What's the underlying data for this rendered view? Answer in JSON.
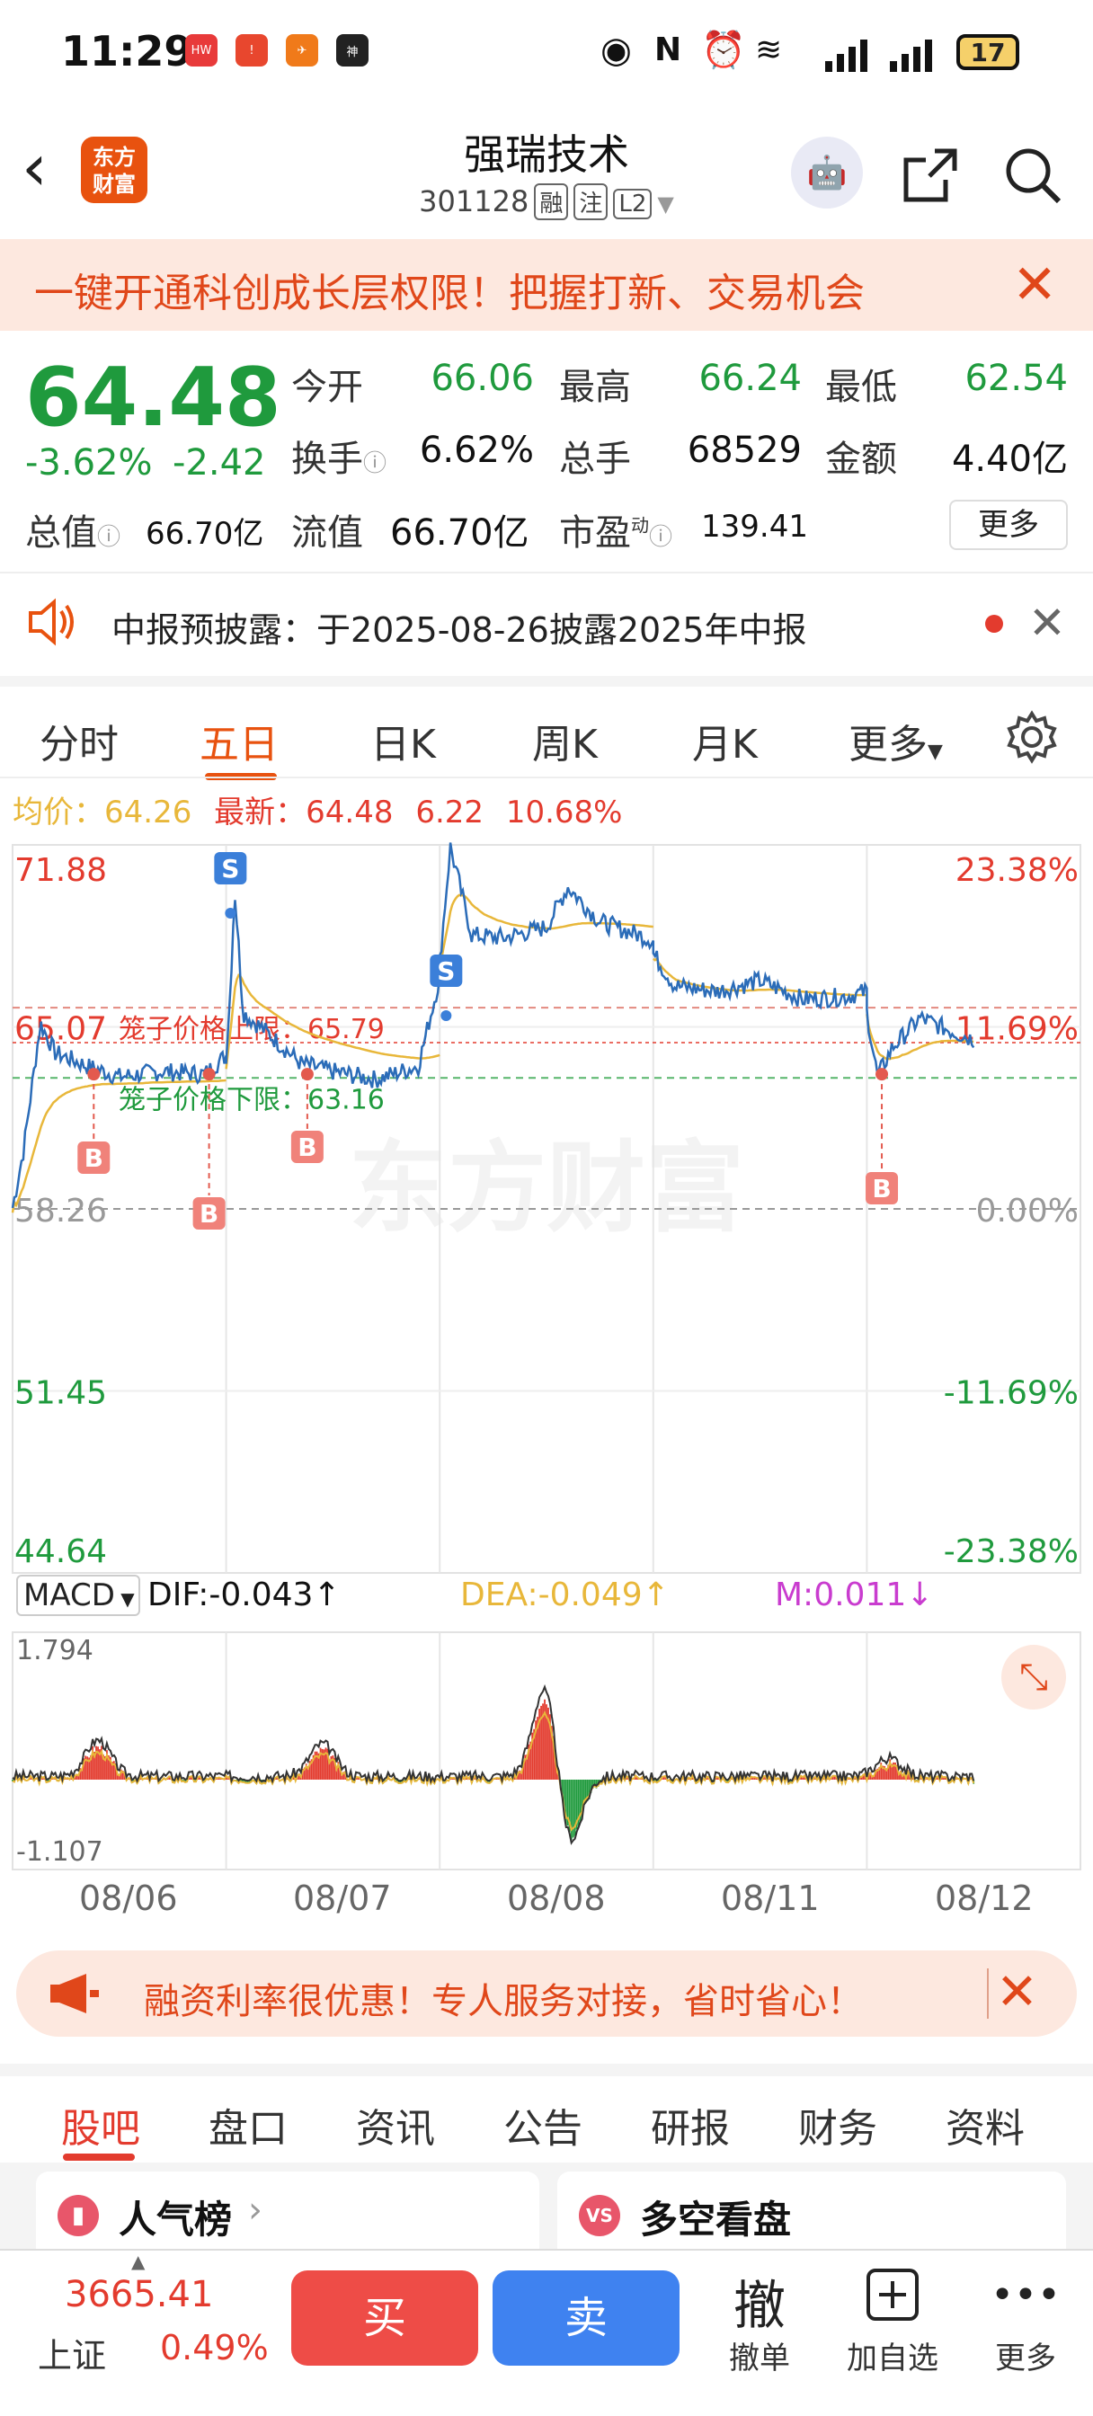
{
  "status_bar": {
    "time": "11:29",
    "battery": "17",
    "apps": [
      "HUAWEI",
      "!",
      "✈",
      "大神"
    ]
  },
  "header": {
    "logo_line1": "东方",
    "logo_line2": "财富",
    "stock_name": "强瑞技术",
    "stock_code": "301128",
    "tags": [
      "融",
      "注",
      "L2"
    ]
  },
  "promo_banner": {
    "text": "一键开通科创成长层权限！把握打新、交易机会"
  },
  "quote": {
    "price": "64.48",
    "change_pct": "-3.62%",
    "change": "-2.42",
    "open_label": "今开",
    "open": "66.06",
    "high_label": "最高",
    "high": "66.24",
    "low_label": "最低",
    "low": "62.54",
    "turnover_label": "换手",
    "turnover": "6.62%",
    "volume_label": "总手",
    "volume": "68529",
    "amount_label": "金额",
    "amount": "4.40亿",
    "total_mv_label": "总值",
    "total_mv": "66.70亿",
    "float_mv_label": "流值",
    "float_mv": "66.70亿",
    "pe_label": "市盈",
    "pe_sup": "动",
    "pe": "139.41",
    "more_label": "更多"
  },
  "notice": {
    "text": "中报预披露：于2025-08-26披露2025年中报"
  },
  "chart_tabs": [
    "分时",
    "五日",
    "日K",
    "周K",
    "月K",
    "更多"
  ],
  "active_chart_tab": "五日",
  "chart_summary": {
    "avg_label": "均价：",
    "avg": "64.26",
    "latest_label": "最新：",
    "latest": "64.48",
    "change": "6.22",
    "change_pct": "10.68%"
  },
  "chart_data": {
    "type": "line",
    "y_left_ticks": [
      "71.88",
      "65.07",
      "58.26",
      "51.45",
      "44.64"
    ],
    "y_right_ticks": [
      "23.38%",
      "11.69%",
      "0.00%",
      "-11.69%",
      "-23.38%"
    ],
    "ylim": [
      44.64,
      71.88
    ],
    "dates": [
      "08/06",
      "08/07",
      "08/08",
      "08/11",
      "08/12"
    ],
    "upper_limit_label": "笼子价格上限：",
    "upper_limit": "65.79",
    "lower_limit_label": "笼子价格下限：",
    "lower_limit": "63.16",
    "markers": [
      {
        "type": "S",
        "day": 1,
        "pos": 0.02
      },
      {
        "type": "S",
        "day": 2,
        "pos": 0.03
      },
      {
        "type": "B",
        "day": 0,
        "pos": 0.38
      },
      {
        "type": "B",
        "day": 0,
        "pos": 0.92
      },
      {
        "type": "B",
        "day": 1,
        "pos": 0.38
      },
      {
        "type": "B",
        "day": 4,
        "pos": 0.07
      }
    ],
    "macd": {
      "selector": "MACD",
      "dif": "DIF:-0.043",
      "dea": "DEA:-0.049",
      "m": "M:0.011",
      "ymax": "1.794",
      "ymin": "-1.107"
    }
  },
  "ad_banner": {
    "text": "融资利率很优惠！专人服务对接，省时省心！"
  },
  "bottom_tabs": [
    "股吧",
    "盘口",
    "资讯",
    "公告",
    "研报",
    "财务",
    "资料"
  ],
  "cards": [
    "人气榜",
    "多空看盘"
  ],
  "footer": {
    "index_value": "3665.41",
    "index_name": "上证",
    "index_pct": "0.49%",
    "buy": "买",
    "sell": "卖",
    "cancel_icon": "撤",
    "cancel": "撤单",
    "add_watch": "加自选",
    "more": "更多"
  },
  "colors": {
    "up": "#e33b2e",
    "down": "#1f9a3d",
    "brand": "#e8520f",
    "price_line": "#2b6cb8",
    "avg_line": "#e8b73a"
  }
}
